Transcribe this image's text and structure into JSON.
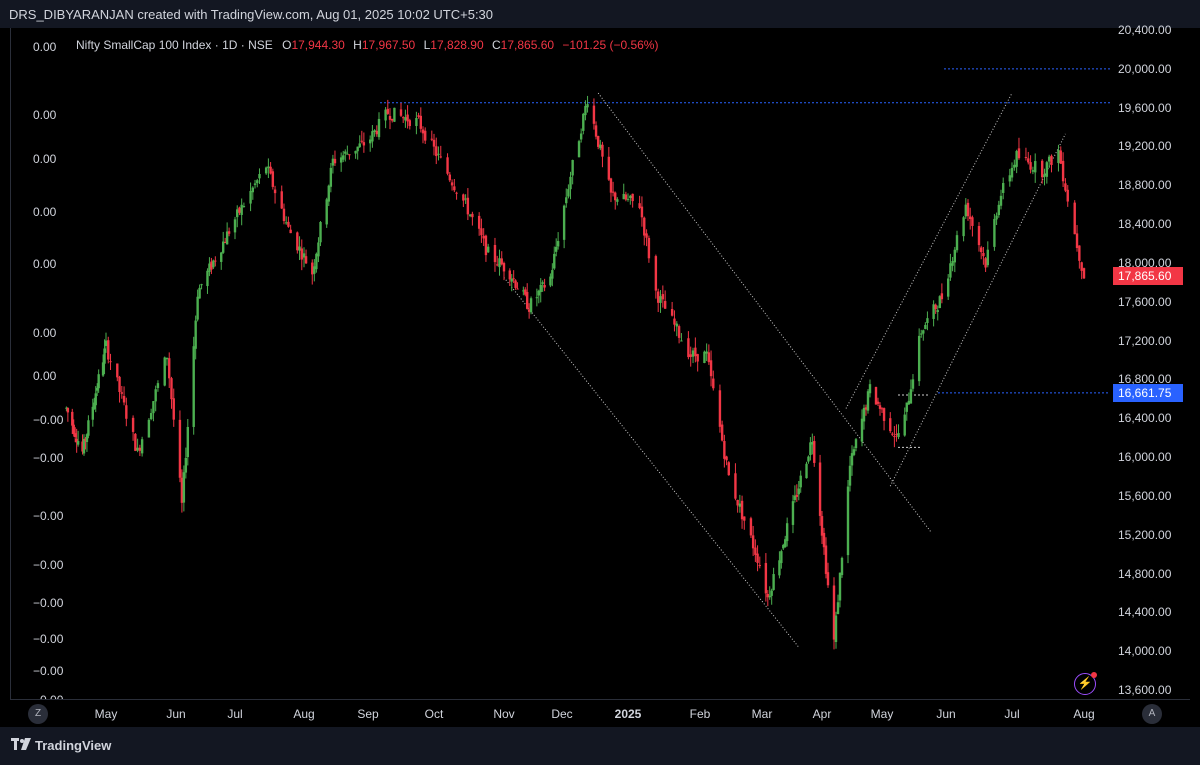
{
  "header": {
    "caption": "DRS_DIBYARANJAN created with TradingView.com, Aug 01, 2025 10:02 UTC+5:30"
  },
  "legend": {
    "title": "Nifty SmallCap 100 Index · 1D · NSE",
    "o_label": "O",
    "o_value": "17,944.30",
    "h_label": "H",
    "h_value": "17,967.50",
    "l_label": "L",
    "l_value": "17,828.90",
    "c_label": "C",
    "c_value": "17,865.60",
    "change": "−101.25 (−0.56%)"
  },
  "left_scale": {
    "labels": [
      "0.00",
      "0.00",
      "0.00",
      "0.00",
      "0.00",
      "0.00",
      "0.00",
      "−0.00",
      "−0.00",
      "−0.00",
      "−0.00",
      "−0.00",
      "−0.00",
      "−0.00",
      "−0.00"
    ]
  },
  "price_axis": {
    "labels": [
      "20,400.00",
      "20,000.00",
      "19,600.00",
      "19,200.00",
      "18,800.00",
      "18,400.00",
      "18,000.00",
      "17,600.00",
      "17,200.00",
      "16,800.00",
      "16,400.00",
      "16,000.00",
      "15,600.00",
      "15,200.00",
      "14,800.00",
      "14,400.00",
      "14,000.00",
      "13,600.00"
    ],
    "last_price_tag": "17,865.60",
    "level_tag": "16,661.75"
  },
  "time_axis": {
    "labels": [
      "May",
      "Jun",
      "Jul",
      "Aug",
      "Sep",
      "Oct",
      "Nov",
      "Dec",
      "2025",
      "Feb",
      "Mar",
      "Apr",
      "May",
      "Jun",
      "Jul",
      "Aug"
    ],
    "left_button": "Z",
    "right_button": "A"
  },
  "footer": {
    "brand": "TradingView"
  },
  "colors": {
    "up": "#4caf50",
    "down": "#f23645",
    "level_blue": "#2962ff",
    "tag_blue": "#2962ff",
    "trendline": "#c8c8c8"
  },
  "chart_data": {
    "type": "candlestick",
    "title": "Nifty SmallCap 100 Index · 1D · NSE",
    "ylim": [
      13600,
      20400
    ],
    "x_range": [
      "2024-04-01",
      "2025-08-08"
    ],
    "ohlc_points": [
      {
        "date": "2024-04-04",
        "price": 16500
      },
      {
        "date": "2024-04-15",
        "price": 16050
      },
      {
        "date": "2024-05-01",
        "price": 17150
      },
      {
        "date": "2024-05-15",
        "price": 16050
      },
      {
        "date": "2024-05-28",
        "price": 17050
      },
      {
        "date": "2024-06-04",
        "price": 15500
      },
      {
        "date": "2024-06-12",
        "price": 17700
      },
      {
        "date": "2024-07-01",
        "price": 18450
      },
      {
        "date": "2024-07-15",
        "price": 19000
      },
      {
        "date": "2024-07-25",
        "price": 18350
      },
      {
        "date": "2024-08-05",
        "price": 17900
      },
      {
        "date": "2024-08-15",
        "price": 19050
      },
      {
        "date": "2024-09-01",
        "price": 19250
      },
      {
        "date": "2024-09-10",
        "price": 19550
      },
      {
        "date": "2024-09-24",
        "price": 19450
      },
      {
        "date": "2024-10-04",
        "price": 19050
      },
      {
        "date": "2024-10-15",
        "price": 18600
      },
      {
        "date": "2024-10-25",
        "price": 18100
      },
      {
        "date": "2024-11-04",
        "price": 17900
      },
      {
        "date": "2024-11-14",
        "price": 17550
      },
      {
        "date": "2024-11-25",
        "price": 17850
      },
      {
        "date": "2024-12-05",
        "price": 18900
      },
      {
        "date": "2024-12-13",
        "price": 19700
      },
      {
        "date": "2024-12-24",
        "price": 18700
      },
      {
        "date": "2025-01-06",
        "price": 18600
      },
      {
        "date": "2025-01-13",
        "price": 17700
      },
      {
        "date": "2025-01-28",
        "price": 17050
      },
      {
        "date": "2025-02-04",
        "price": 17050
      },
      {
        "date": "2025-02-14",
        "price": 15800
      },
      {
        "date": "2025-02-28",
        "price": 14900
      },
      {
        "date": "2025-03-04",
        "price": 14550
      },
      {
        "date": "2025-03-20",
        "price": 15700
      },
      {
        "date": "2025-03-27",
        "price": 16200
      },
      {
        "date": "2025-04-07",
        "price": 14100
      },
      {
        "date": "2025-04-15",
        "price": 15900
      },
      {
        "date": "2025-04-25",
        "price": 16700
      },
      {
        "date": "2025-05-08",
        "price": 16200
      },
      {
        "date": "2025-05-12",
        "price": 16400
      },
      {
        "date": "2025-05-20",
        "price": 17300
      },
      {
        "date": "2025-05-30",
        "price": 17650
      },
      {
        "date": "2025-06-10",
        "price": 18600
      },
      {
        "date": "2025-06-19",
        "price": 18000
      },
      {
        "date": "2025-06-25",
        "price": 18650
      },
      {
        "date": "2025-07-03",
        "price": 19100
      },
      {
        "date": "2025-07-14",
        "price": 18950
      },
      {
        "date": "2025-07-21",
        "price": 19150
      },
      {
        "date": "2025-07-28",
        "price": 18300
      },
      {
        "date": "2025-08-01",
        "price": 17865.6
      }
    ],
    "horizontal_levels": [
      19650,
      20000,
      16661.75
    ],
    "trendlines": [
      {
        "from": {
          "date": "2024-12-18",
          "price": 19750
        },
        "to": {
          "date": "2025-05-25",
          "price": 15220
        }
      },
      {
        "from": {
          "date": "2024-11-01",
          "price": 17850
        },
        "to": {
          "date": "2025-03-20",
          "price": 14040
        }
      },
      {
        "from": {
          "date": "2025-04-13",
          "price": 16500
        },
        "to": {
          "date": "2025-07-01",
          "price": 19750
        }
      },
      {
        "from": {
          "date": "2025-05-05",
          "price": 15700
        },
        "to": {
          "date": "2025-07-24",
          "price": 19330
        }
      }
    ]
  }
}
